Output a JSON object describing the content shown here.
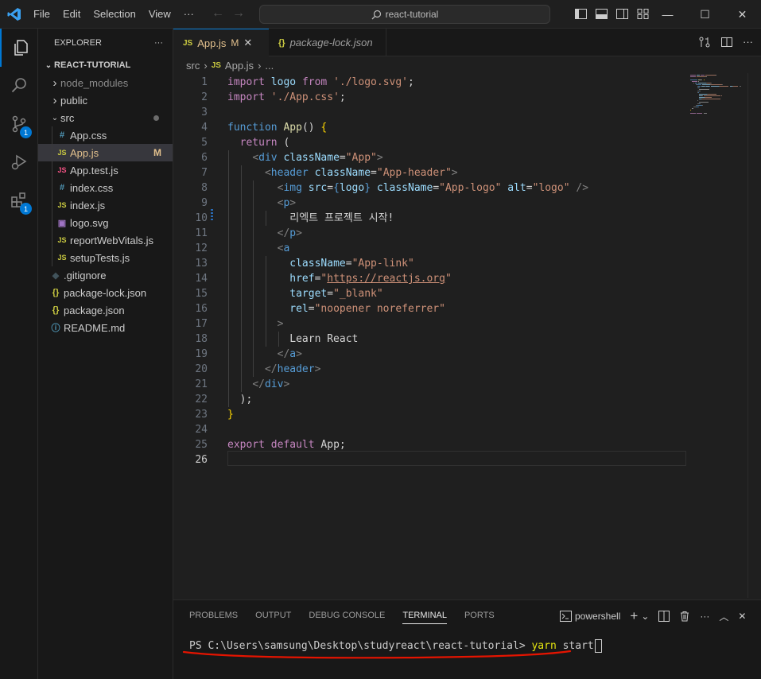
{
  "titlebar": {
    "menu": [
      "File",
      "Edit",
      "Selection",
      "View",
      "···"
    ],
    "search": "react-tutorial"
  },
  "activity_bar": {
    "items": [
      {
        "name": "explorer",
        "badge": null
      },
      {
        "name": "search",
        "badge": null
      },
      {
        "name": "source-control",
        "badge": "1"
      },
      {
        "name": "run-debug",
        "badge": null
      },
      {
        "name": "extensions",
        "badge": "1"
      }
    ]
  },
  "sidebar": {
    "title": "EXPLORER",
    "more": "···",
    "root": "REACT-TUTORIAL",
    "items": [
      {
        "label": "node_modules",
        "kind": "folder",
        "state": "closed",
        "depth": 0,
        "icon": "",
        "icon_color": "",
        "muted": true
      },
      {
        "label": "public",
        "kind": "folder",
        "state": "closed",
        "depth": 0,
        "icon": "",
        "icon_color": ""
      },
      {
        "label": "src",
        "kind": "folder",
        "state": "open",
        "depth": 0,
        "icon": "",
        "icon_color": ""
      },
      {
        "label": "App.css",
        "kind": "file",
        "depth": 1,
        "icon": "#",
        "icon_color": "#519aba"
      },
      {
        "label": "App.js",
        "kind": "file",
        "depth": 1,
        "icon": "JS",
        "icon_color": "#cbcb41",
        "status": "M",
        "selected": true
      },
      {
        "label": "App.test.js",
        "kind": "file",
        "depth": 1,
        "icon": "JS",
        "icon_color": "#f55385"
      },
      {
        "label": "index.css",
        "kind": "file",
        "depth": 1,
        "icon": "#",
        "icon_color": "#519aba"
      },
      {
        "label": "index.js",
        "kind": "file",
        "depth": 1,
        "icon": "JS",
        "icon_color": "#cbcb41"
      },
      {
        "label": "logo.svg",
        "kind": "file",
        "depth": 1,
        "icon": "▣",
        "icon_color": "#a074c4"
      },
      {
        "label": "reportWebVitals.js",
        "kind": "file",
        "depth": 1,
        "icon": "JS",
        "icon_color": "#cbcb41"
      },
      {
        "label": "setupTests.js",
        "kind": "file",
        "depth": 1,
        "icon": "JS",
        "icon_color": "#cbcb41"
      },
      {
        "label": ".gitignore",
        "kind": "file",
        "depth": 0,
        "icon": "◆",
        "icon_color": "#41535b"
      },
      {
        "label": "package-lock.json",
        "kind": "file",
        "depth": 0,
        "icon": "{}",
        "icon_color": "#cbcb41"
      },
      {
        "label": "package.json",
        "kind": "file",
        "depth": 0,
        "icon": "{}",
        "icon_color": "#cbcb41"
      },
      {
        "label": "README.md",
        "kind": "file",
        "depth": 0,
        "icon": "ⓘ",
        "icon_color": "#519aba"
      }
    ]
  },
  "editor": {
    "tabs": [
      {
        "label": "App.js",
        "icon": "JS",
        "status": "M",
        "active": true
      },
      {
        "label": "package-lock.json",
        "icon": "{}",
        "active": false
      }
    ],
    "breadcrumb": [
      "src",
      "App.js",
      "..."
    ],
    "current_line": 26,
    "lines": [
      [
        [
          "import",
          "c"
        ],
        [
          " logo ",
          "a"
        ],
        [
          "from",
          "c"
        ],
        [
          " ",
          "w"
        ],
        [
          "'./logo.svg'",
          "s"
        ],
        [
          ";",
          "w"
        ]
      ],
      [
        [
          "import",
          "c"
        ],
        [
          " ",
          "w"
        ],
        [
          "'./App.css'",
          "s"
        ],
        [
          ";",
          "w"
        ]
      ],
      [],
      [
        [
          "function",
          "k"
        ],
        [
          " ",
          "w"
        ],
        [
          "App",
          "f"
        ],
        [
          "() ",
          "w"
        ],
        [
          "{",
          "y"
        ]
      ],
      [
        [
          "  ",
          "w"
        ],
        [
          "return",
          "c"
        ],
        [
          " (",
          "w"
        ]
      ],
      [
        [
          "    ",
          "w"
        ],
        [
          "<",
          "g"
        ],
        [
          "div",
          "t"
        ],
        [
          " className",
          "a"
        ],
        [
          "=",
          "w"
        ],
        [
          "\"App\"",
          "s"
        ],
        [
          ">",
          "g"
        ]
      ],
      [
        [
          "      ",
          "w"
        ],
        [
          "<",
          "g"
        ],
        [
          "header",
          "t"
        ],
        [
          " className",
          "a"
        ],
        [
          "=",
          "w"
        ],
        [
          "\"App-header\"",
          "s"
        ],
        [
          ">",
          "g"
        ]
      ],
      [
        [
          "        ",
          "w"
        ],
        [
          "<",
          "g"
        ],
        [
          "img",
          "t"
        ],
        [
          " src",
          "a"
        ],
        [
          "=",
          "w"
        ],
        [
          "{",
          "k"
        ],
        [
          "logo",
          "a"
        ],
        [
          "}",
          "k"
        ],
        [
          " className",
          "a"
        ],
        [
          "=",
          "w"
        ],
        [
          "\"App-logo\"",
          "s"
        ],
        [
          " alt",
          "a"
        ],
        [
          "=",
          "w"
        ],
        [
          "\"logo\"",
          "s"
        ],
        [
          " />",
          "g"
        ]
      ],
      [
        [
          "        ",
          "w"
        ],
        [
          "<",
          "g"
        ],
        [
          "p",
          "t"
        ],
        [
          ">",
          "g"
        ]
      ],
      [
        [
          "          리엑트 프로젝트 시작!",
          "w"
        ]
      ],
      [
        [
          "        ",
          "w"
        ],
        [
          "</",
          "g"
        ],
        [
          "p",
          "t"
        ],
        [
          ">",
          "g"
        ]
      ],
      [
        [
          "        ",
          "w"
        ],
        [
          "<",
          "g"
        ],
        [
          "a",
          "t"
        ]
      ],
      [
        [
          "          ",
          "w"
        ],
        [
          "className",
          "a"
        ],
        [
          "=",
          "w"
        ],
        [
          "\"App-link\"",
          "s"
        ]
      ],
      [
        [
          "          ",
          "w"
        ],
        [
          "href",
          "a"
        ],
        [
          "=",
          "w"
        ],
        [
          "\"",
          "s"
        ],
        [
          "https://reactjs.org",
          "su"
        ],
        [
          "\"",
          "s"
        ]
      ],
      [
        [
          "          ",
          "w"
        ],
        [
          "target",
          "a"
        ],
        [
          "=",
          "w"
        ],
        [
          "\"_blank\"",
          "s"
        ]
      ],
      [
        [
          "          ",
          "w"
        ],
        [
          "rel",
          "a"
        ],
        [
          "=",
          "w"
        ],
        [
          "\"noopener noreferrer\"",
          "s"
        ]
      ],
      [
        [
          "        ",
          "w"
        ],
        [
          ">",
          "g"
        ]
      ],
      [
        [
          "          Learn React",
          "w"
        ]
      ],
      [
        [
          "        ",
          "w"
        ],
        [
          "</",
          "g"
        ],
        [
          "a",
          "t"
        ],
        [
          ">",
          "g"
        ]
      ],
      [
        [
          "      ",
          "w"
        ],
        [
          "</",
          "g"
        ],
        [
          "header",
          "t"
        ],
        [
          ">",
          "g"
        ]
      ],
      [
        [
          "    ",
          "w"
        ],
        [
          "</",
          "g"
        ],
        [
          "div",
          "t"
        ],
        [
          ">",
          "g"
        ]
      ],
      [
        [
          "  );",
          "w"
        ]
      ],
      [
        [
          "}",
          "y"
        ]
      ],
      [],
      [
        [
          "export",
          "c"
        ],
        [
          " ",
          "w"
        ],
        [
          "default",
          "c"
        ],
        [
          " App;",
          "w"
        ]
      ],
      []
    ]
  },
  "panel": {
    "tabs": [
      "PROBLEMS",
      "OUTPUT",
      "DEBUG CONSOLE",
      "TERMINAL",
      "PORTS"
    ],
    "active_tab": "TERMINAL",
    "shell": "powershell",
    "terminal": {
      "prompt": "PS C:\\Users\\samsung\\Desktop\\studyreact\\react-tutorial> ",
      "command": "yarn",
      "args": " start"
    }
  },
  "colors": {
    "accent": "#0078d4",
    "annotation": "#e51400",
    "modified": "#e2c08d"
  }
}
